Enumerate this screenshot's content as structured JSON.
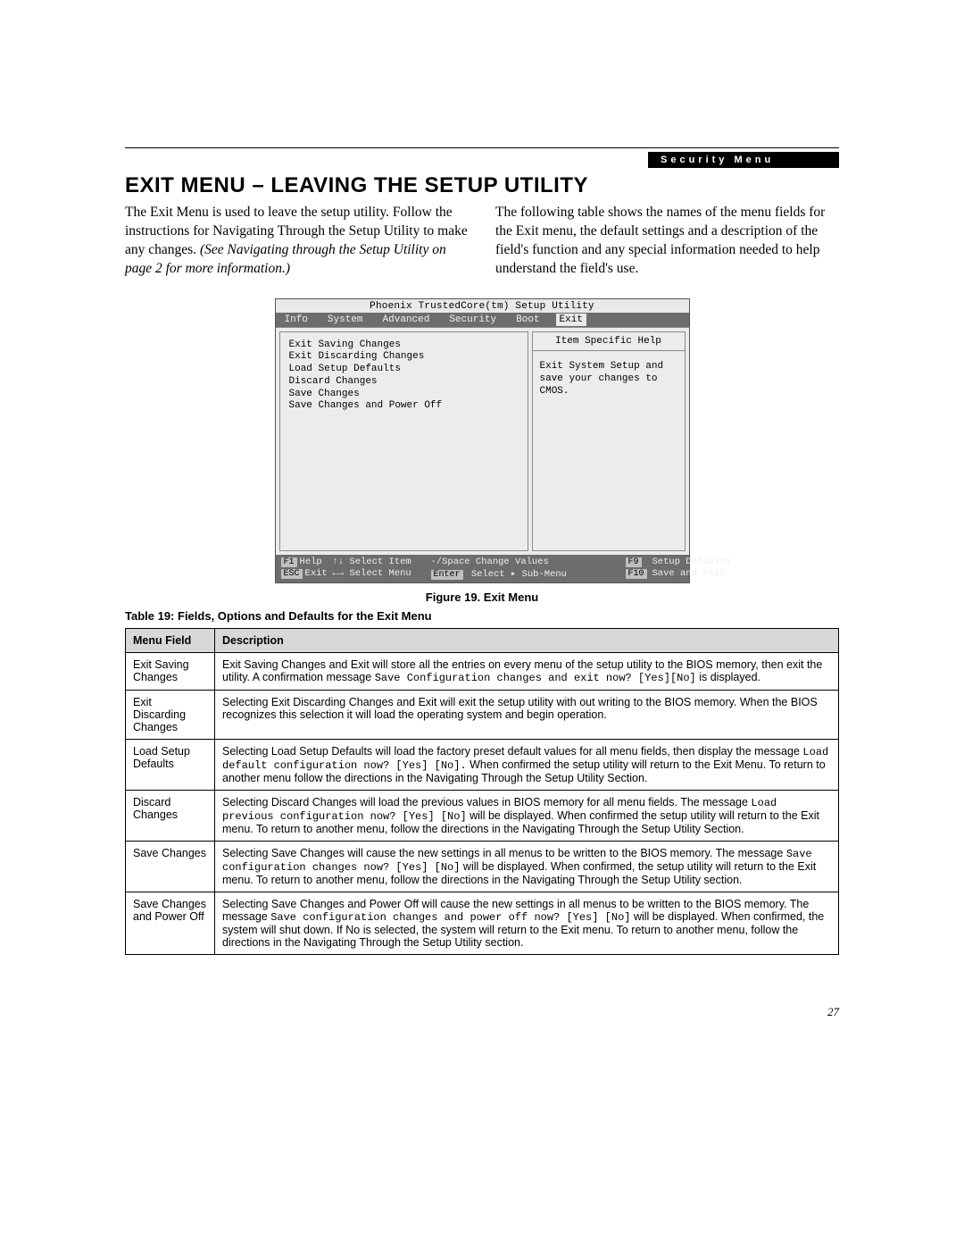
{
  "header_tag": "Security Menu",
  "heading": "EXIT MENU – LEAVING THE SETUP UTILITY",
  "para_left_a": "The Exit Menu is used to leave the setup utility. Follow the instructions for Navigating Through the Setup Utility to make any changes. ",
  "para_left_b": "(See Navigating through the Setup Utility on page 2 for more information.)",
  "para_right": "The following table shows the names of the menu fields for the Exit menu, the default settings and a description of the field's function and any special information needed to help understand the field's use.",
  "bios": {
    "title": "Phoenix TrustedCore(tm) Setup Utility",
    "tabs": [
      "Info",
      "System",
      "Advanced",
      "Security",
      "Boot",
      "Exit"
    ],
    "active_tab": "Exit",
    "menu_items": [
      "Exit Saving Changes",
      "Exit Discarding Changes",
      "Load Setup Defaults",
      "Discard Changes",
      "Save Changes",
      "Save Changes and Power Off"
    ],
    "help_title": "Item Specific Help",
    "help_body": "Exit System Setup and save your changes to CMOS.",
    "footer": {
      "r1": {
        "k1": "F1",
        "t1": "Help",
        "k2": "↑↓",
        "t2": "Select Item",
        "k3": "-/Space",
        "t3": "Change Values",
        "k4": "F9",
        "t4": "Setup Defaults"
      },
      "r2": {
        "k1": "ESC",
        "t1": "Exit",
        "k2": "←→",
        "t2": "Select Menu",
        "k3": "Enter",
        "t3": "Select ▸ Sub-Menu",
        "k4": "F10",
        "t4": "Save and Exit"
      }
    }
  },
  "figure_caption": "Figure 19.  Exit Menu",
  "table_caption": "Table 19: Fields, Options and Defaults for the Exit Menu",
  "columns": {
    "field": "Menu Field",
    "desc": "Description"
  },
  "rows": [
    {
      "field": "Exit Saving Changes",
      "pre": "Exit Saving Changes and Exit will store all the entries on every menu of the setup utility to the BIOS memory, then exit the utility. A confirmation message ",
      "code": "Save Configuration changes and exit now? [Yes][No]",
      "post": " is displayed."
    },
    {
      "field": "Exit Discarding Changes",
      "pre": "Selecting Exit Discarding Changes and Exit will exit the setup utility with out writing to the BIOS memory. When the BIOS recognizes this selection it will load the operating system and begin operation.",
      "code": "",
      "post": ""
    },
    {
      "field": "Load Setup Defaults",
      "pre": "Selecting Load Setup Defaults will load the factory preset default values for all menu fields, then display the message ",
      "code": "Load default configuration now? [Yes] [No].",
      "post": " When confirmed the setup utility will return to the Exit Menu. To return to another menu follow the directions in the Navigating Through the Setup Utility Section."
    },
    {
      "field": "Discard Changes",
      "pre": "Selecting Discard Changes will load the previous values in BIOS memory for all menu fields. The message ",
      "code": "Load previous configuration now? [Yes] [No]",
      "post": " will be displayed. When confirmed the setup utility will return to the Exit menu. To return to another menu, follow the directions in the Navigating Through the Setup Utility Section."
    },
    {
      "field": "Save Changes",
      "pre": "Selecting Save Changes will cause the new settings in all menus to be written to the BIOS memory. The message ",
      "code": "Save configuration changes now? [Yes] [No]",
      "post": " will be displayed. When confirmed, the setup utility will return to the Exit menu. To return to another menu, follow the directions in the Navigating Through the Setup Utility section."
    },
    {
      "field": "Save Changes and Power Off",
      "pre": "Selecting Save Changes and Power Off will cause the new settings in all menus to be written to the BIOS memory. The message ",
      "code": "Save configuration changes and power off now? [Yes] [No]",
      "post": " will be displayed. When confirmed, the system will shut down. If No is selected, the system will return to the Exit menu. To return to another menu, follow the directions in the Navigating Through the Setup Utility section."
    }
  ],
  "page_number": "27"
}
